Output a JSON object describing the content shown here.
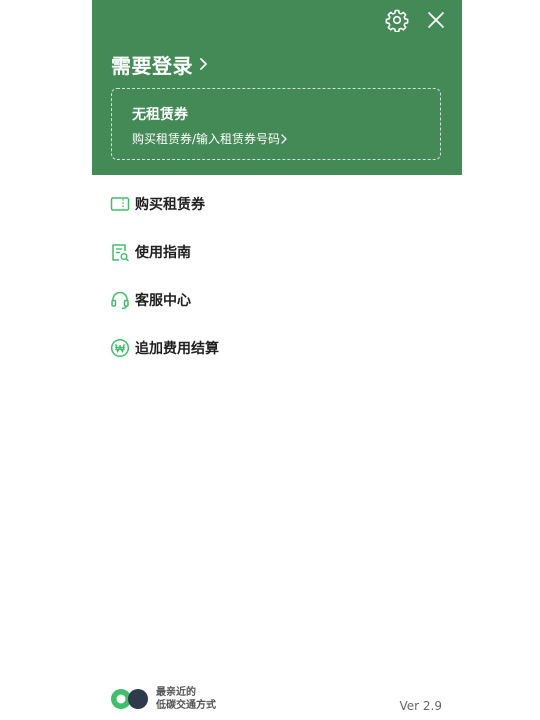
{
  "header": {
    "login_label": "需要登录",
    "coupon": {
      "title": "无租赁券",
      "subtitle": "购买租赁券/输入租赁券号码"
    }
  },
  "menu": {
    "items": [
      {
        "label": "购买租赁券",
        "icon": "ticket-icon"
      },
      {
        "label": "使用指南",
        "icon": "guide-icon"
      },
      {
        "label": "客服中心",
        "icon": "headset-icon"
      },
      {
        "label": "追加费用结算",
        "icon": "won-coin-icon"
      }
    ]
  },
  "footer": {
    "logo_line1": "最亲近的",
    "logo_line2": "低碳交通方式",
    "version": "Ver 2.9"
  },
  "colors": {
    "header_bg": "#438a56",
    "accent_green": "#3fbf6a",
    "logo_dark": "#2f3b4a"
  }
}
